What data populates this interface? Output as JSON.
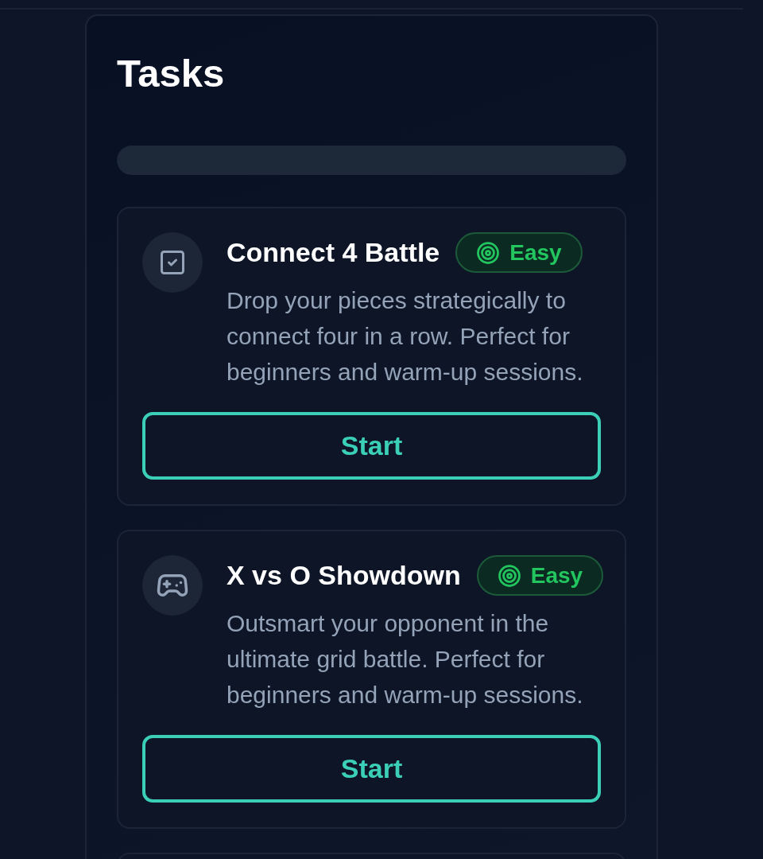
{
  "panel": {
    "title": "Tasks"
  },
  "tasks": [
    {
      "title": "Connect 4 Battle",
      "difficulty": "Easy",
      "description": "Drop your pieces strategically to connect four in a row. Perfect for beginners and warm-up sessions.",
      "button": "Start"
    },
    {
      "title": "X vs O Showdown",
      "difficulty": "Easy",
      "description": "Outsmart your opponent in the ultimate grid battle. Perfect for beginners and warm-up sessions.",
      "button": "Start"
    }
  ]
}
